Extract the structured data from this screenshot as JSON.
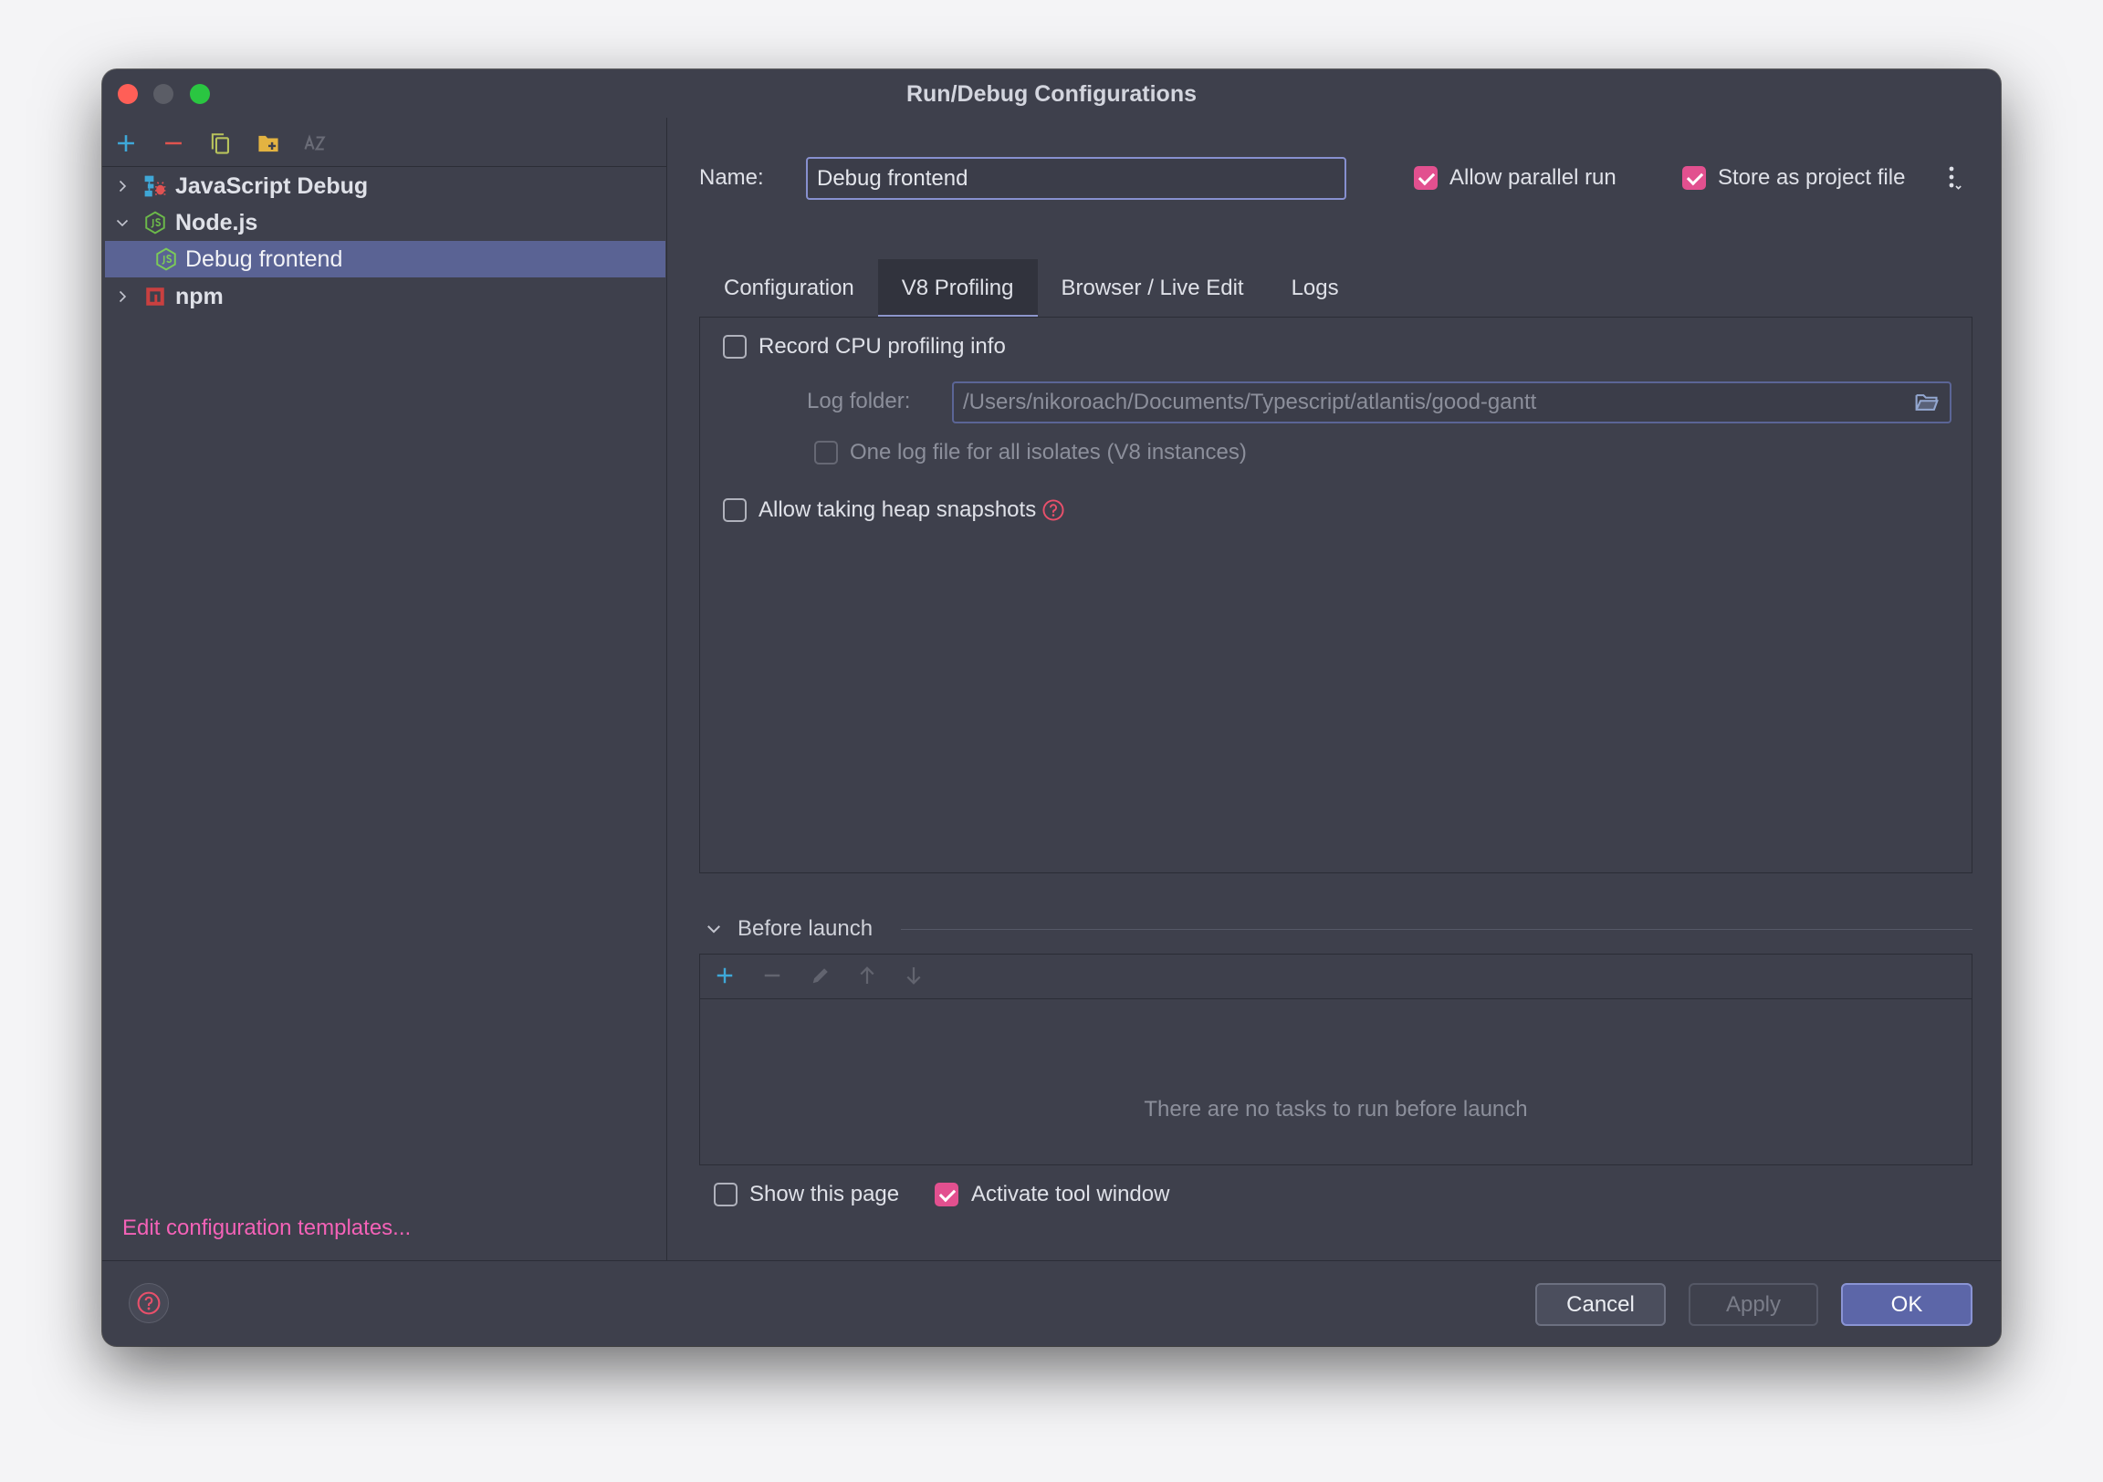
{
  "window": {
    "title": "Run/Debug Configurations"
  },
  "colors": {
    "window_bg": "#3e404c",
    "checkbox_checked": "#e2508f",
    "link": "#f462b7",
    "selection": "#5a6394",
    "ok_button": "#5c66a8"
  },
  "sidebar": {
    "toolbar_icons": [
      "add-icon",
      "remove-icon",
      "copy-icon",
      "add-folder-icon",
      "sort-alphabetically-icon"
    ],
    "tree": [
      {
        "label": "JavaScript Debug",
        "icon": "javascript-debug-icon",
        "expanded": false
      },
      {
        "label": "Node.js",
        "icon": "nodejs-icon",
        "expanded": true,
        "children": [
          {
            "label": "Debug frontend",
            "icon": "nodejs-icon",
            "selected": true
          }
        ]
      },
      {
        "label": "npm",
        "icon": "npm-icon",
        "expanded": false
      }
    ],
    "edit_templates_link": "Edit configuration templates..."
  },
  "header": {
    "name_label": "Name:",
    "name_value": "Debug frontend",
    "allow_parallel_run": {
      "label": "Allow parallel run",
      "checked": true
    },
    "store_as_project_file": {
      "label": "Store as project file",
      "checked": true
    }
  },
  "tabs": [
    {
      "label": "Configuration",
      "selected": false
    },
    {
      "label": "V8 Profiling",
      "selected": true
    },
    {
      "label": "Browser / Live Edit",
      "selected": false
    },
    {
      "label": "Logs",
      "selected": false
    }
  ],
  "v8_profiling": {
    "record_cpu": {
      "label": "Record CPU profiling info",
      "checked": false
    },
    "log_folder": {
      "label": "Log folder:",
      "value": "/Users/nikoroach/Documents/Typescript/atlantis/good-gantt",
      "enabled": false
    },
    "one_log_file": {
      "label": "One log file for all isolates (V8 instances)",
      "checked": false,
      "enabled": false
    },
    "heap_snapshots": {
      "label": "Allow taking heap snapshots",
      "checked": false
    }
  },
  "before_launch": {
    "title": "Before launch",
    "expanded": true,
    "toolbar_icons": [
      "add-icon",
      "remove-icon",
      "edit-icon",
      "move-up-icon",
      "move-down-icon"
    ],
    "empty_text": "There are no tasks to run before launch"
  },
  "launch_options": {
    "show_this_page": {
      "label": "Show this page",
      "checked": false
    },
    "activate_tool_window": {
      "label": "Activate tool window",
      "checked": true
    }
  },
  "footer": {
    "buttons": {
      "cancel": "Cancel",
      "apply": "Apply",
      "ok": "OK"
    },
    "apply_enabled": false
  }
}
